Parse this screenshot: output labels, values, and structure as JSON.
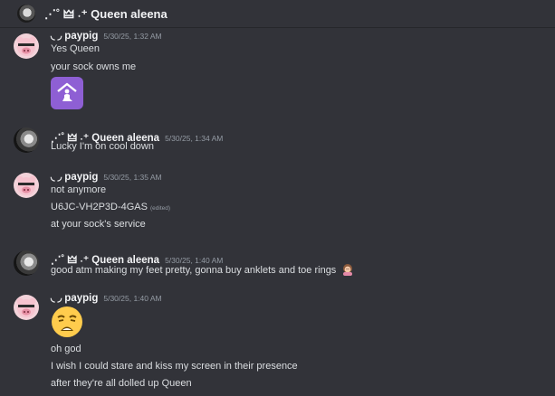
{
  "header": {
    "title": "⋰˚ 🜲 ˖⁺ Queen aleena",
    "avatar_icon": "user-avatar"
  },
  "messages": [
    {
      "author": "◟ ◞ paypig",
      "timestamp": "5/30/25, 1:32 AM",
      "lines": [
        "Yes Queen",
        "your sock owns me"
      ],
      "sticker": "kneeling-person-sticker"
    },
    {
      "author": "⋰˚ 🜲 ˖⁺ Queen aleena",
      "timestamp": "5/30/25, 1:34 AM",
      "lines": [
        "Lucky I'm on cool down"
      ]
    },
    {
      "author": "◟ ◞ paypig",
      "timestamp": "5/30/25, 1:35 AM",
      "lines": [
        "not anymore",
        "U6JC-VH2P3D-4GAS",
        "at your sock's service"
      ],
      "edited_label": "(edited)"
    },
    {
      "author": "⋰˚ 🜲 ˖⁺ Queen aleena",
      "timestamp": "5/30/25, 1:40 AM",
      "lines": [
        "good atm making my feet pretty, gonna buy anklets and toe rings"
      ],
      "trailing_emoji": "woman-getting-manicure-emoji"
    },
    {
      "author": "◟ ◞ paypig",
      "timestamp": "5/30/25, 1:40 AM",
      "big_emoji": "weary-face-emoji",
      "lines": [
        "oh god",
        "I wish I could stare and kiss my screen in their presence",
        "after they're all dolled up Queen"
      ]
    }
  ],
  "colors": {
    "background": "#323339",
    "text": "#dbdee1",
    "username": "#f2f3f5",
    "timestamp": "#949ba4",
    "sticker_bg": "#8e5fd4"
  }
}
